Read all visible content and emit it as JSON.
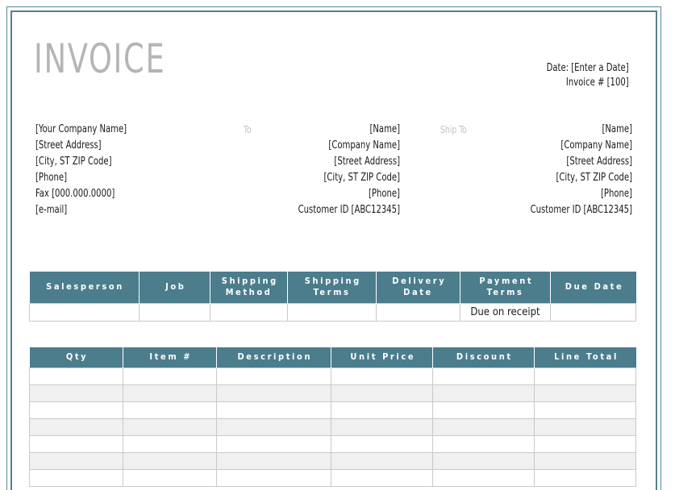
{
  "document": {
    "title": "INVOICE",
    "accent_color": "#4B7D8D",
    "frame_color": "#53808F",
    "title_color": "#B5B5B5",
    "label_color": "#C2C2C2",
    "stripe_color": "#F0F0F0"
  },
  "meta": {
    "date_line": "Date: [Enter a Date]",
    "invoice_number_line": "Invoice # [100]"
  },
  "from": {
    "lines": [
      "[Your Company Name]",
      "[Street Address]",
      "[City, ST  ZIP Code]",
      "[Phone]",
      "Fax [000.000.0000]",
      "[e-mail]"
    ]
  },
  "bill_to": {
    "label": "To",
    "lines": [
      "[Name]",
      "[Company Name]",
      "[Street Address]",
      "[City, ST  ZIP Code]",
      "[Phone]"
    ],
    "customer_id": "Customer ID [ABC12345]"
  },
  "ship_to": {
    "label": "Ship To",
    "lines": [
      "[Name]",
      "[Company Name]",
      "[Street Address]",
      "[City, ST  ZIP Code]",
      "[Phone]"
    ],
    "customer_id": "Customer ID [ABC12345]"
  },
  "terms_table": {
    "headers": [
      "Salesperson",
      "Job",
      "Shipping Method",
      "Shipping Terms",
      "Delivery Date",
      "Payment Terms",
      "Due Date"
    ],
    "rows": [
      [
        "",
        "",
        "",
        "",
        "",
        "Due on receipt",
        ""
      ]
    ]
  },
  "items_table": {
    "headers": [
      "Qty",
      "Item #",
      "Description",
      "Unit Price",
      "Discount",
      "Line Total"
    ],
    "rows": [
      [
        "",
        "",
        "",
        "",
        "",
        ""
      ],
      [
        "",
        "",
        "",
        "",
        "",
        ""
      ],
      [
        "",
        "",
        "",
        "",
        "",
        ""
      ],
      [
        "",
        "",
        "",
        "",
        "",
        ""
      ],
      [
        "",
        "",
        "",
        "",
        "",
        ""
      ],
      [
        "",
        "",
        "",
        "",
        "",
        ""
      ],
      [
        "",
        "",
        "",
        "",
        "",
        ""
      ]
    ]
  }
}
